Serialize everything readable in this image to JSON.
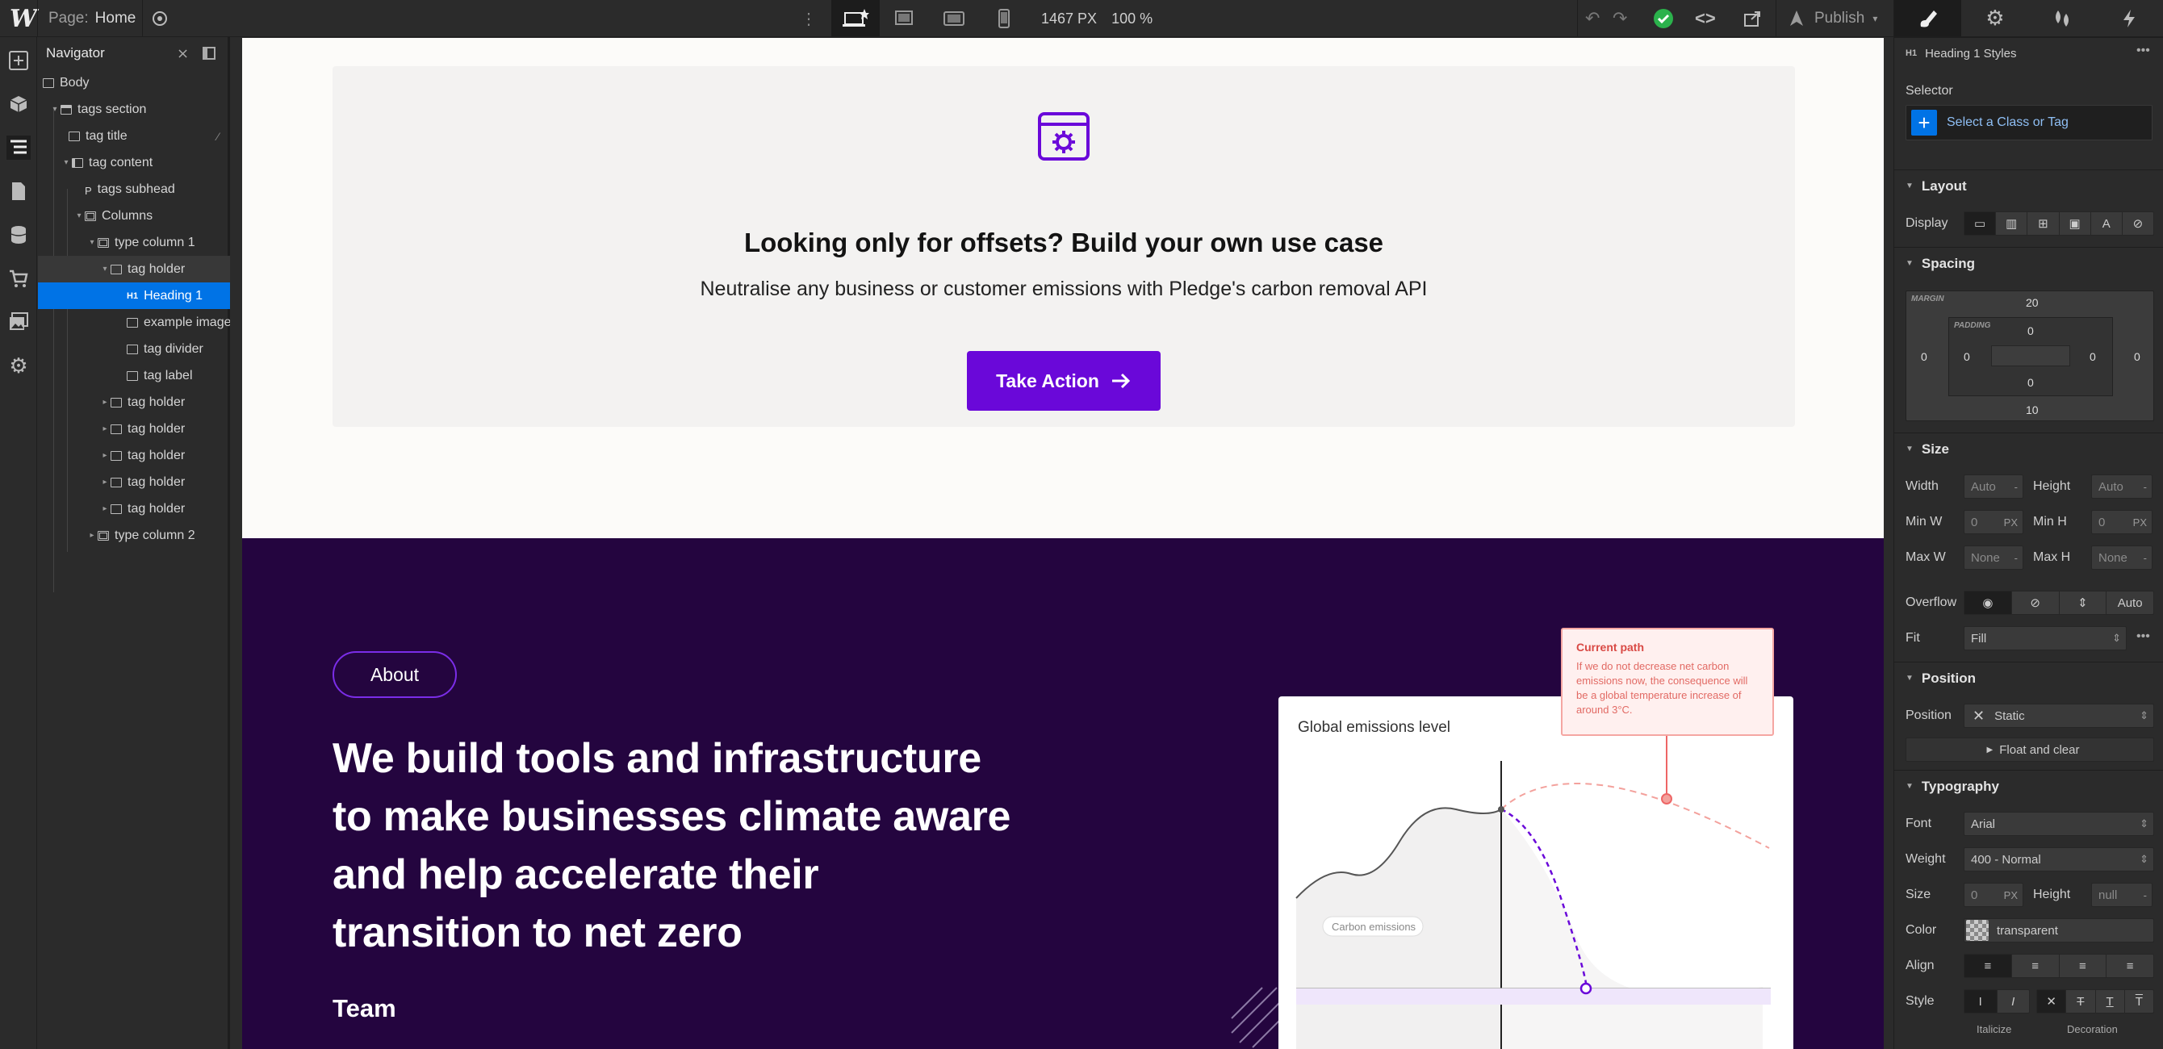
{
  "topbar": {
    "logo": "W",
    "page_label": "Page:",
    "page_name": "Home",
    "width_readout": "1467 PX",
    "zoom_readout": "100 %",
    "publish_label": "Publish"
  },
  "navigator": {
    "title": "Navigator",
    "items": [
      {
        "label": "Body",
        "icon": "box"
      },
      {
        "label": "tags section",
        "icon": "section"
      },
      {
        "label": "tag title",
        "icon": "text"
      },
      {
        "label": "tag content",
        "icon": "columns"
      },
      {
        "label": "tags subhead",
        "icon": "paragraph"
      },
      {
        "label": "Columns",
        "icon": "grid"
      },
      {
        "label": "type column 1",
        "icon": "columns"
      },
      {
        "label": "tag holder",
        "icon": "box"
      },
      {
        "label": "Heading 1",
        "icon": "heading"
      },
      {
        "label": "example image",
        "icon": "text"
      },
      {
        "label": "tag divider",
        "icon": "box"
      },
      {
        "label": "tag label",
        "icon": "text"
      },
      {
        "label": "tag holder",
        "icon": "box"
      },
      {
        "label": "tag holder",
        "icon": "box"
      },
      {
        "label": "tag holder",
        "icon": "box"
      },
      {
        "label": "tag holder",
        "icon": "box"
      },
      {
        "label": "tag holder",
        "icon": "box"
      },
      {
        "label": "type column 2",
        "icon": "columns"
      }
    ],
    "heading_icon_text": "H1",
    "para_icon_text": "P"
  },
  "canvas": {
    "card": {
      "heading": "Looking only for offsets? Build your own use case",
      "text": "Neutralise any business or customer emissions with Pledge's carbon removal API",
      "button": "Take Action"
    },
    "about": {
      "pill": "About",
      "hero_lines": [
        "We build tools and infrastructure",
        "to make businesses climate aware",
        "and help accelerate their",
        "transition to net zero"
      ],
      "team": "Team"
    },
    "chart": {
      "title": "Global emissions level",
      "inner_label": "Carbon emissions",
      "tooltip_title": "Current path",
      "tooltip_body": "If we do not decrease net carbon emissions now, the consequence will be a global temperature increase of around 3°C."
    }
  },
  "panel": {
    "element_tag": "H1",
    "element_title": "Heading 1 Styles",
    "selector_label": "Selector",
    "selector_placeholder": "Select a Class or Tag",
    "layout": {
      "title": "Layout",
      "display_label": "Display"
    },
    "spacing": {
      "title": "Spacing",
      "margin_label": "MARGIN",
      "padding_label": "PADDING",
      "margin_top": "20",
      "margin_left": "0",
      "margin_right": "0",
      "margin_bottom": "10",
      "padding_top": "0",
      "padding_left": "0",
      "padding_right": "0",
      "padding_bottom": "0"
    },
    "size": {
      "title": "Size",
      "width_label": "Width",
      "height_label": "Height",
      "minw_label": "Min W",
      "minh_label": "Min H",
      "maxw_label": "Max W",
      "maxh_label": "Max H",
      "width": "Auto",
      "height": "Auto",
      "minw": "0",
      "minh": "0",
      "maxw": "None",
      "maxh": "None",
      "unit": "PX",
      "overflow_label": "Overflow",
      "overflow_auto": "Auto",
      "fit_label": "Fit",
      "fit_value": "Fill"
    },
    "position": {
      "title": "Position",
      "label": "Position",
      "value": "Static",
      "float_label": "Float and clear"
    },
    "typography": {
      "title": "Typography",
      "font_label": "Font",
      "font_value": "Arial",
      "weight_label": "Weight",
      "weight_value": "400 - Normal",
      "size_label": "Size",
      "size_value": "0",
      "size_unit": "PX",
      "height_label": "Height",
      "height_value": "null",
      "color_label": "Color",
      "color_value": "transparent",
      "align_label": "Align",
      "style_label": "Style",
      "italicize_label": "Italicize",
      "decoration_label": "Decoration"
    }
  },
  "colors": {
    "accent": "#0073e6",
    "brand_purple": "#6a08d9",
    "dark_bg": "#24053f",
    "publish_green": "#2bb24c"
  }
}
